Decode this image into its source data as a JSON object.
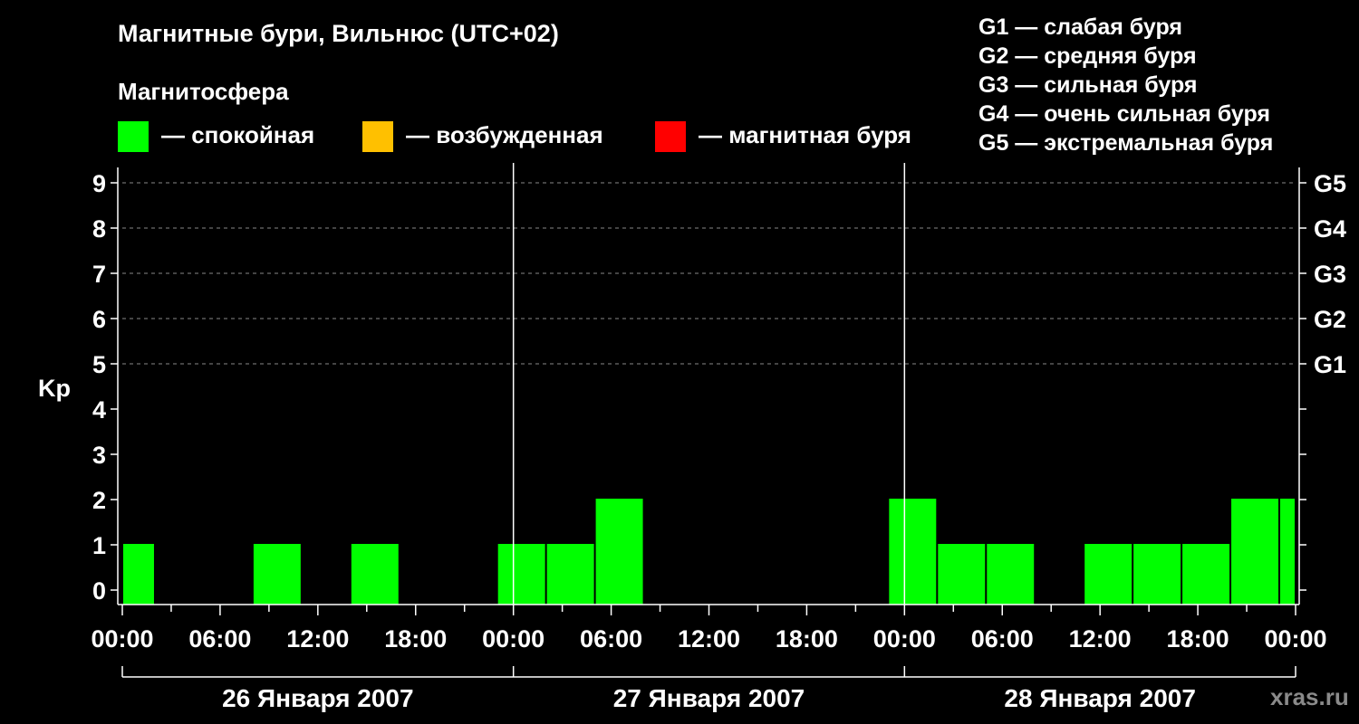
{
  "title": "Магнитные бури, Вильнюс (UTC+02)",
  "subtitle": "Магнитосфера",
  "legend": [
    {
      "label": "— спокойная",
      "color": "#00ff00"
    },
    {
      "label": "— возбужденная",
      "color": "#ffc000"
    },
    {
      "label": "— магнитная буря",
      "color": "#ff0000"
    }
  ],
  "g_scale": [
    "G1 — слабая буря",
    "G2 — средняя буря",
    "G3 — сильная буря",
    "G4 — очень сильная буря",
    "G5 — экстремальная буря"
  ],
  "watermark": "xras.ru",
  "chart_data": {
    "type": "bar",
    "ylabel": "Kp",
    "ylim": [
      0,
      9
    ],
    "yticks": [
      "0",
      "1",
      "2",
      "3",
      "4",
      "5",
      "6",
      "7",
      "8",
      "9"
    ],
    "right_ticks": [
      {
        "value": 5,
        "label": "G1"
      },
      {
        "value": 6,
        "label": "G2"
      },
      {
        "value": 7,
        "label": "G3"
      },
      {
        "value": 8,
        "label": "G4"
      },
      {
        "value": 9,
        "label": "G5"
      }
    ],
    "x_tick_labels": [
      "00:00",
      "06:00",
      "12:00",
      "18:00",
      "00:00",
      "06:00",
      "12:00",
      "18:00",
      "00:00",
      "06:00",
      "12:00",
      "18:00",
      "00:00",
      "06:00",
      "12:00",
      "18:00",
      "00:00"
    ],
    "days": [
      "26 Января 2007",
      "27 Января 2007",
      "28 Января 2007"
    ],
    "grid": "dashed at Kp 5-9",
    "bars": [
      {
        "day": 0,
        "start_hour": 0,
        "end_hour": 2,
        "kp": 1
      },
      {
        "day": 0,
        "start_hour": 8,
        "end_hour": 11,
        "kp": 1
      },
      {
        "day": 0,
        "start_hour": 14,
        "end_hour": 17,
        "kp": 1
      },
      {
        "day": 0,
        "start_hour": 23,
        "end_hour": 26,
        "kp": 1
      },
      {
        "day": 1,
        "start_hour": 2,
        "end_hour": 5,
        "kp": 1
      },
      {
        "day": 1,
        "start_hour": 5,
        "end_hour": 8,
        "kp": 2
      },
      {
        "day": 1,
        "start_hour": 23,
        "end_hour": 26,
        "kp": 2
      },
      {
        "day": 2,
        "start_hour": 2,
        "end_hour": 5,
        "kp": 1
      },
      {
        "day": 2,
        "start_hour": 5,
        "end_hour": 8,
        "kp": 1
      },
      {
        "day": 2,
        "start_hour": 11,
        "end_hour": 14,
        "kp": 1
      },
      {
        "day": 2,
        "start_hour": 14,
        "end_hour": 17,
        "kp": 1
      },
      {
        "day": 2,
        "start_hour": 17,
        "end_hour": 20,
        "kp": 1
      },
      {
        "day": 2,
        "start_hour": 20,
        "end_hour": 23,
        "kp": 2
      },
      {
        "day": 2,
        "start_hour": 23,
        "end_hour": 24,
        "kp": 2
      }
    ]
  }
}
